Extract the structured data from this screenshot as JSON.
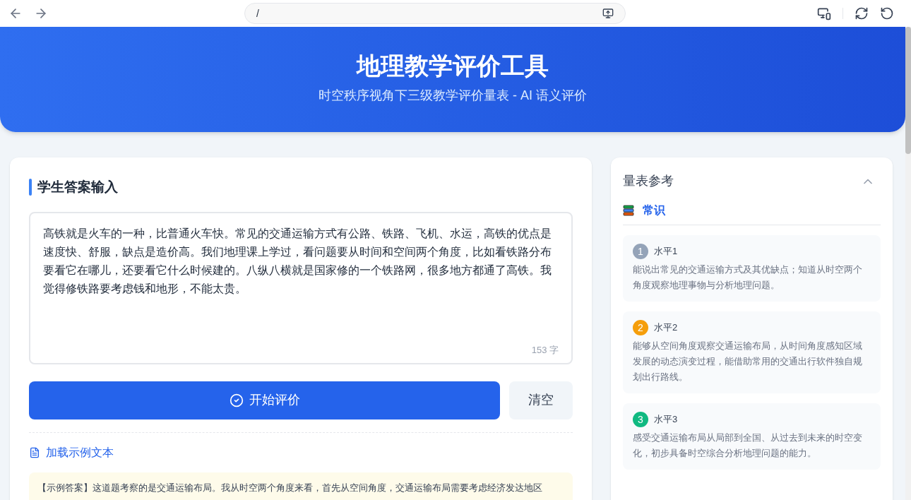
{
  "browser": {
    "address": "/"
  },
  "header": {
    "title": "地理教学评价工具",
    "subtitle": "时空秩序视角下三级教学评价量表 - AI 语义评价"
  },
  "input_card": {
    "title": "学生答案输入",
    "answer": "高铁就是火车的一种，比普通火车快。常见的交通运输方式有公路、铁路、飞机、水运，高铁的优点是速度快、舒服，缺点是造价高。我们地理课上学过，看问题要从时间和空间两个角度，比如看铁路分布要看它在哪儿，还要看它什么时候建的。八纵八横就是国家修的一个铁路网，很多地方都通了高铁。我觉得修铁路要考虑钱和地形，不能太贵。",
    "char_count": "153 字",
    "evaluate_button": "开始评价",
    "clear_button": "清空",
    "load_example_link": "加载示例文本",
    "example_text": "【示例答案】这道题考察的是交通运输布局。我从时空两个角度来看，首先从空间角度，交通运输布局需要考虑经济发达地区"
  },
  "rubric": {
    "title": "量表参考",
    "expanded": true,
    "section": "常识",
    "levels": [
      {
        "number": "1",
        "label": "水平1",
        "color": "#94a3b8",
        "description": "能说出常见的交通运输方式及其优缺点；知道从时空两个角度观察地理事物与分析地理问题。"
      },
      {
        "number": "2",
        "label": "水平2",
        "color": "#f59e0b",
        "description": "能够从空间角度观察交通运输布局，从时间角度感知区域发展的动态演变过程，能借助常用的交通出行软件独自规划出行路线。"
      },
      {
        "number": "3",
        "label": "水平3",
        "color": "#10b981",
        "description": "感受交通运输布局从局部到全国、从过去到未来的时空变化，初步具备时空综合分析地理问题的能力。"
      }
    ]
  }
}
